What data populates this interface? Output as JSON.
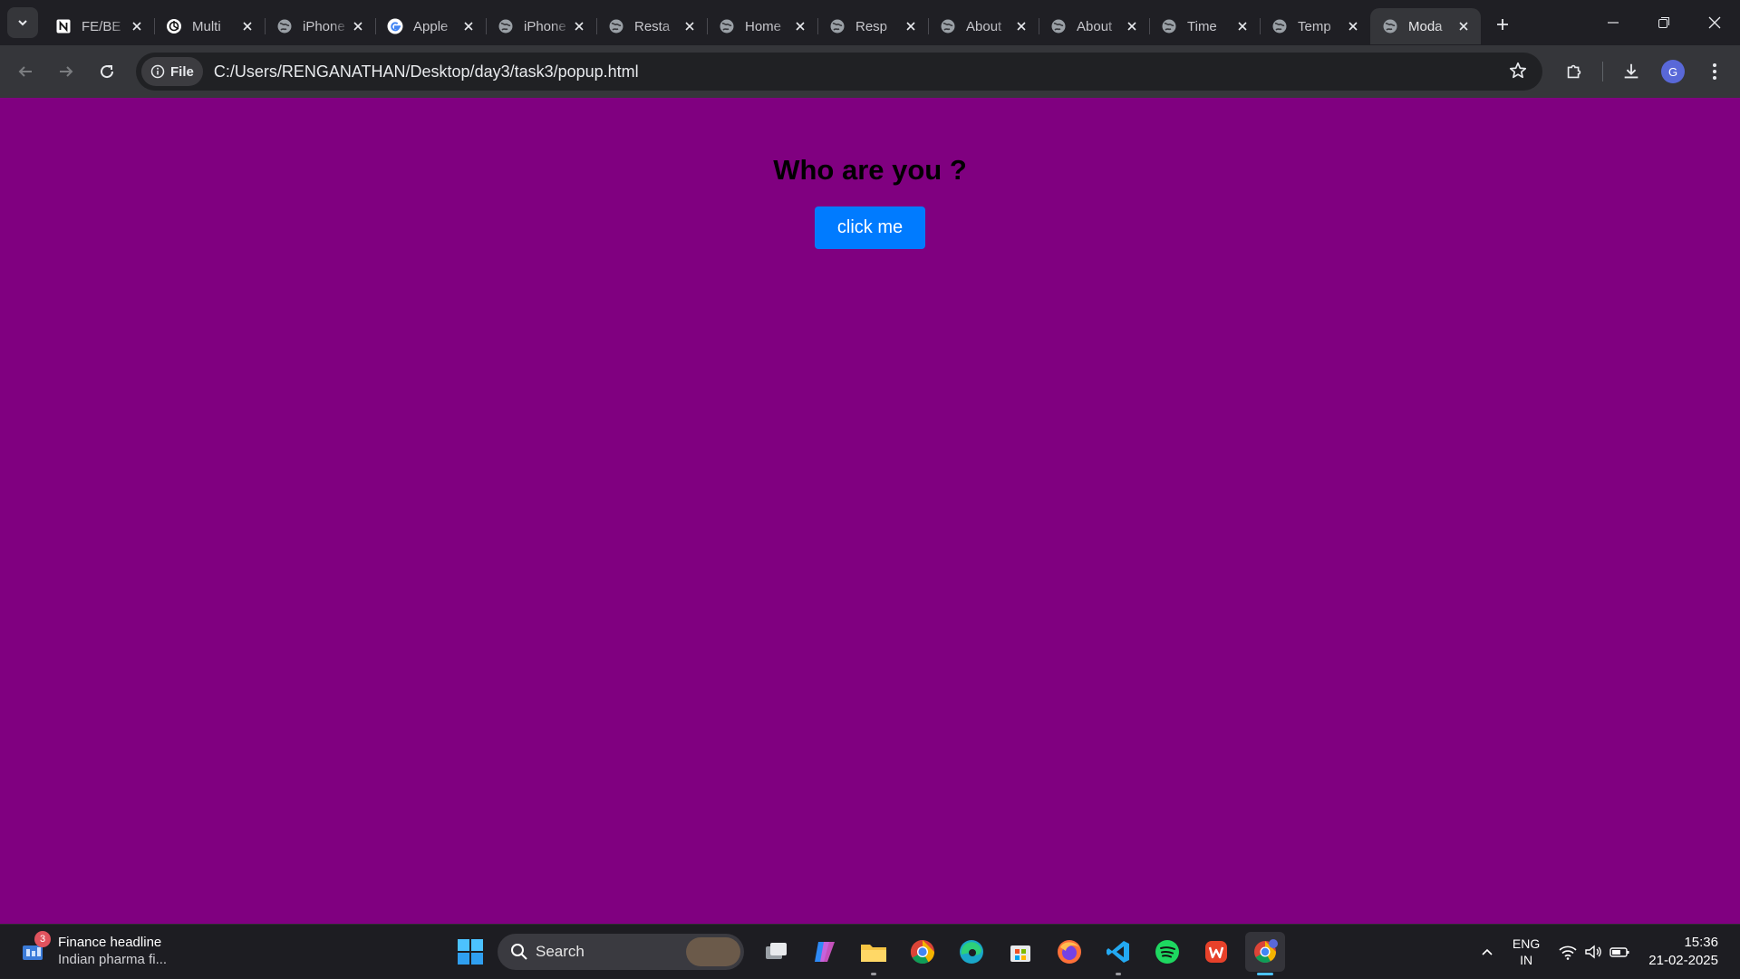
{
  "browser": {
    "tabs": [
      {
        "title": "FE/BE",
        "favicon": "notion-icon"
      },
      {
        "title": "Multi",
        "favicon": "chatgpt-icon"
      },
      {
        "title": "iPhone",
        "favicon": "globe-icon"
      },
      {
        "title": "Apple",
        "favicon": "google-icon"
      },
      {
        "title": "iPhone",
        "favicon": "globe-icon"
      },
      {
        "title": "Resta",
        "favicon": "globe-icon"
      },
      {
        "title": "Home",
        "favicon": "globe-icon"
      },
      {
        "title": "Resp",
        "favicon": "globe-icon"
      },
      {
        "title": "About",
        "favicon": "globe-icon"
      },
      {
        "title": "About",
        "favicon": "globe-icon"
      },
      {
        "title": "Time",
        "favicon": "globe-icon"
      },
      {
        "title": "Temp",
        "favicon": "globe-icon"
      },
      {
        "title": "Moda",
        "favicon": "globe-icon",
        "active": true
      }
    ],
    "address": {
      "chip_label": "File",
      "url": "C:/Users/RENGANATHAN/Desktop/day3/task3/popup.html"
    },
    "profile_initial": "G"
  },
  "page": {
    "heading": "Who are you ?",
    "button_label": "click me",
    "background_color": "#800080",
    "button_color": "#007bff"
  },
  "taskbar": {
    "widget": {
      "badge": "3",
      "title": "Finance headline",
      "subtitle": "Indian pharma fi..."
    },
    "search_label": "Search",
    "apps": [
      "task-view-icon",
      "copilot-icon",
      "file-explorer-icon",
      "chrome-icon",
      "edge-icon",
      "store-icon",
      "firefox-icon",
      "vscode-icon",
      "spotify-icon",
      "wps-icon",
      "chrome-profile-icon"
    ],
    "language": {
      "line1": "ENG",
      "line2": "IN"
    },
    "clock": {
      "time": "15:36",
      "date": "21-02-2025"
    }
  }
}
